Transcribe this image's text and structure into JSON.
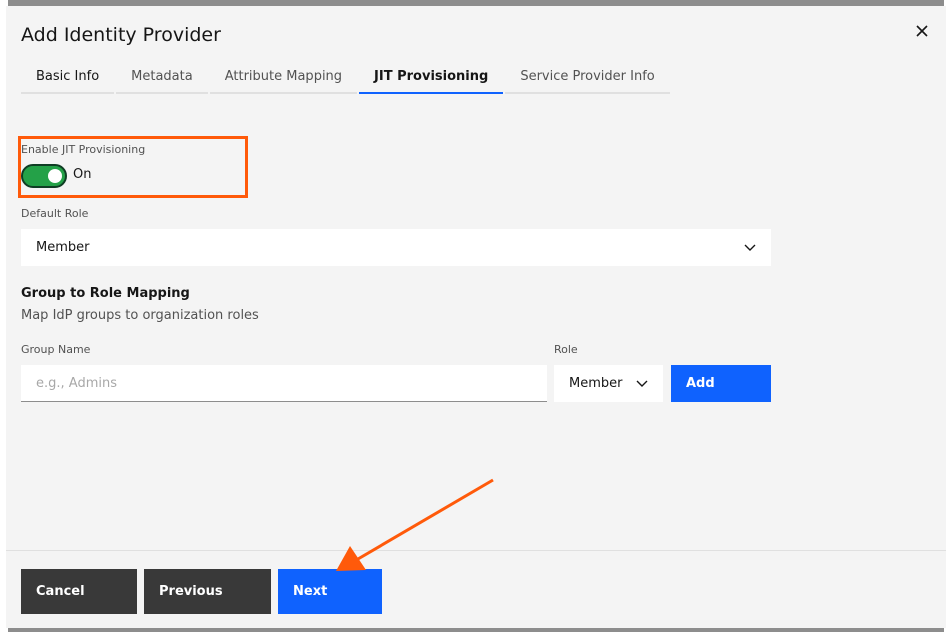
{
  "modal": {
    "title": "Add Identity Provider"
  },
  "tabs": [
    {
      "label": "Basic Info"
    },
    {
      "label": "Metadata"
    },
    {
      "label": "Attribute Mapping"
    },
    {
      "label": "JIT Provisioning"
    },
    {
      "label": "Service Provider Info"
    }
  ],
  "active_tab": "JIT Provisioning",
  "jit": {
    "enable_label": "Enable JIT Provisioning",
    "toggle_state": "On",
    "default_role_label": "Default Role",
    "default_role_value": "Member"
  },
  "group_mapping": {
    "title": "Group to Role Mapping",
    "description": "Map IdP groups to organization roles",
    "group_name_label": "Group Name",
    "group_name_placeholder": "e.g., Admins",
    "role_label": "Role",
    "role_value": "Member",
    "add_label": "Add"
  },
  "footer": {
    "cancel_label": "Cancel",
    "previous_label": "Previous",
    "next_label": "Next"
  },
  "colors": {
    "primary": "#0f62fe",
    "toggle_on": "#24a148",
    "annotation": "#ff5a0a",
    "secondary_button": "#393939"
  },
  "icons": [
    "close-icon",
    "chevron-down-icon"
  ]
}
